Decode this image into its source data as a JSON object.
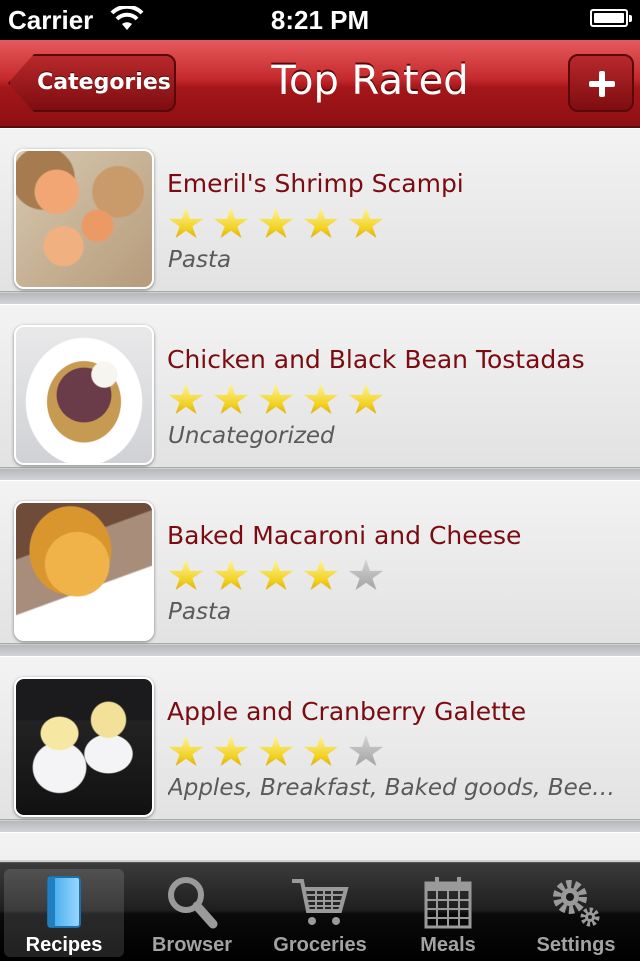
{
  "status_bar": {
    "carrier": "Carrier",
    "time": "8:21 PM",
    "battery_level": 1.0
  },
  "nav_bar": {
    "back_label": "Categories",
    "title": "Top Rated",
    "add_icon": "plus-icon",
    "accent_color": "#b51d21"
  },
  "recipes": [
    {
      "title": "Emeril's Shrimp Scampi",
      "rating": 5,
      "max_rating": 5,
      "category": "Pasta",
      "image": "shrimp-scampi-photo"
    },
    {
      "title": "Chicken and Black Bean Tostadas",
      "rating": 5,
      "max_rating": 5,
      "category": "Uncategorized",
      "image": "tostada-photo"
    },
    {
      "title": "Baked Macaroni and Cheese",
      "rating": 4,
      "max_rating": 5,
      "category": "Pasta",
      "image": "macaroni-photo"
    },
    {
      "title": "Apple and Cranberry Galette",
      "rating": 4,
      "max_rating": 5,
      "category": "Apples, Breakfast, Baked goods, Bee…",
      "image": "galette-photo"
    }
  ],
  "tab_bar": {
    "tabs": [
      {
        "label": "Recipes",
        "icon": "book-icon",
        "active": true
      },
      {
        "label": "Browser",
        "icon": "magnifier-icon",
        "active": false
      },
      {
        "label": "Groceries",
        "icon": "cart-icon",
        "active": false
      },
      {
        "label": "Meals",
        "icon": "calendar-icon",
        "active": false
      },
      {
        "label": "Settings",
        "icon": "gears-icon",
        "active": false
      }
    ]
  }
}
